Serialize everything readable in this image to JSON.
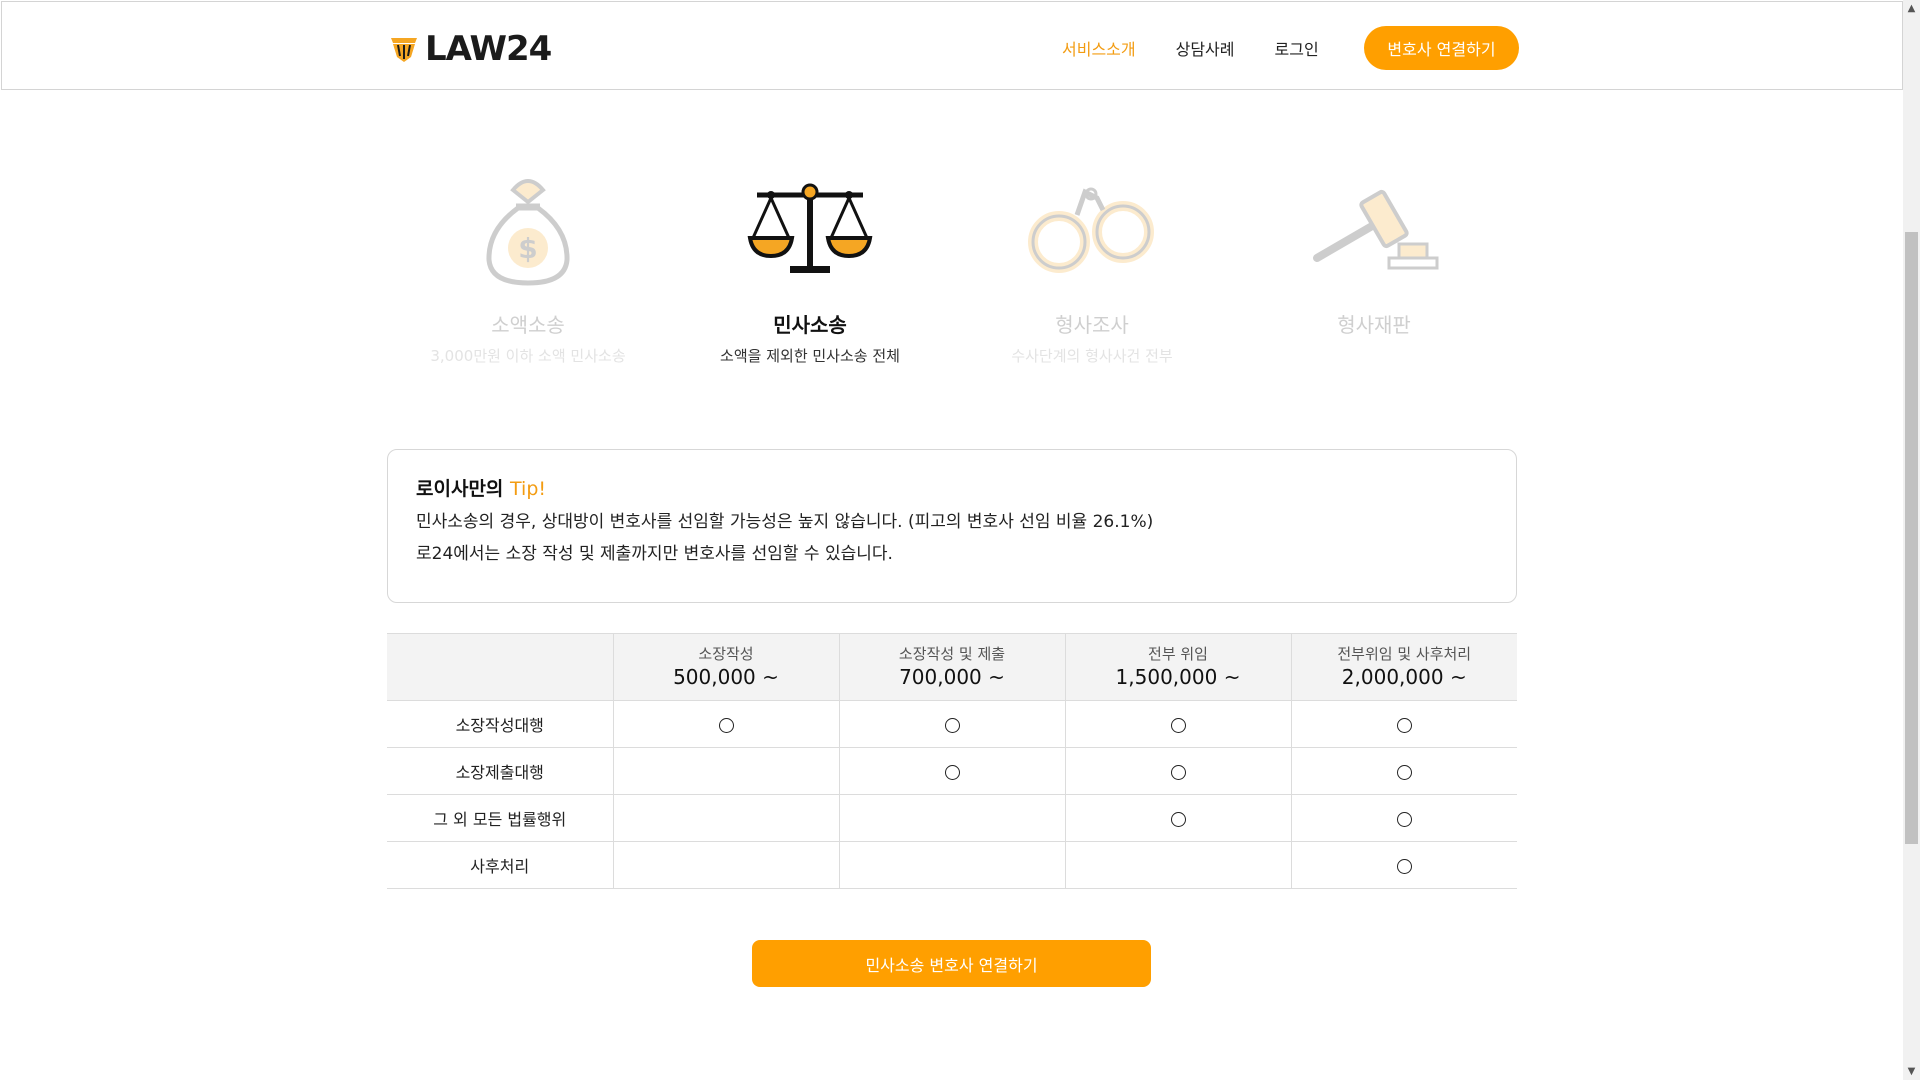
{
  "brand": {
    "name": "LAW24",
    "accent_color": "#ff9f00",
    "active_text_color": "#f39c12"
  },
  "nav": {
    "items": [
      {
        "label": "서비스소개",
        "active": true
      },
      {
        "label": "상담사례",
        "active": false
      },
      {
        "label": "로그인",
        "active": false
      }
    ],
    "cta_label": "변호사 연결하기"
  },
  "categories": [
    {
      "icon": "money-bag-icon",
      "title": "소액소송",
      "desc": "3,000만원 이하 소액 민사소송",
      "active": false
    },
    {
      "icon": "scales-icon",
      "title": "민사소송",
      "desc": "소액을 제외한 민사소송 전체",
      "active": true
    },
    {
      "icon": "handcuffs-icon",
      "title": "형사조사",
      "desc": "수사단계의 형사사건 전부",
      "active": false
    },
    {
      "icon": "gavel-icon",
      "title": "형사재판",
      "desc": "",
      "active": false
    }
  ],
  "tip": {
    "title_prefix": "로이사만의 ",
    "title_accent": "Tip!",
    "lines": [
      "민사소송의 경우, 상대방이 변호사를 선임할 가능성은 높지 않습니다. (피고의 변호사 선임 비율 26.1%)",
      "로24에서는 소장 작성 및 제출까지만 변호사를 선임할 수 있습니다."
    ]
  },
  "table": {
    "plans": [
      {
        "name": "소장작성",
        "price": "500,000 ~"
      },
      {
        "name": "소장작성 및 제출",
        "price": "700,000 ~"
      },
      {
        "name": "전부 위임",
        "price": "1,500,000 ~"
      },
      {
        "name": "전부위임 및 사후처리",
        "price": "2,000,000 ~"
      }
    ],
    "rows": [
      {
        "label": "소장작성대행",
        "included": [
          true,
          true,
          true,
          true
        ]
      },
      {
        "label": "소장제출대행",
        "included": [
          false,
          true,
          true,
          true
        ]
      },
      {
        "label": "그 외 모든 법률행위",
        "included": [
          false,
          false,
          true,
          true
        ]
      },
      {
        "label": "사후처리",
        "included": [
          false,
          false,
          false,
          true
        ]
      }
    ]
  },
  "bottom_cta_label": "민사소송 변호사 연결하기"
}
